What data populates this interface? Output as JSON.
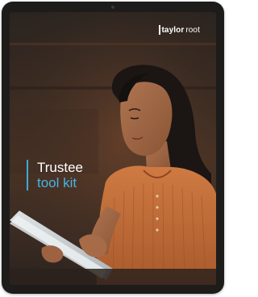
{
  "brand": {
    "name_part1": "taylor",
    "name_part2": "root"
  },
  "cover": {
    "title_line1": "Trustee",
    "title_line2": "tool kit"
  },
  "colors": {
    "accent_rule": "#3fa9d6",
    "accent_text": "#47b4e2",
    "device_frame": "#1e1c1b",
    "shirt": "#c8703a"
  },
  "image": {
    "subject": "woman-using-tablet-photo"
  }
}
